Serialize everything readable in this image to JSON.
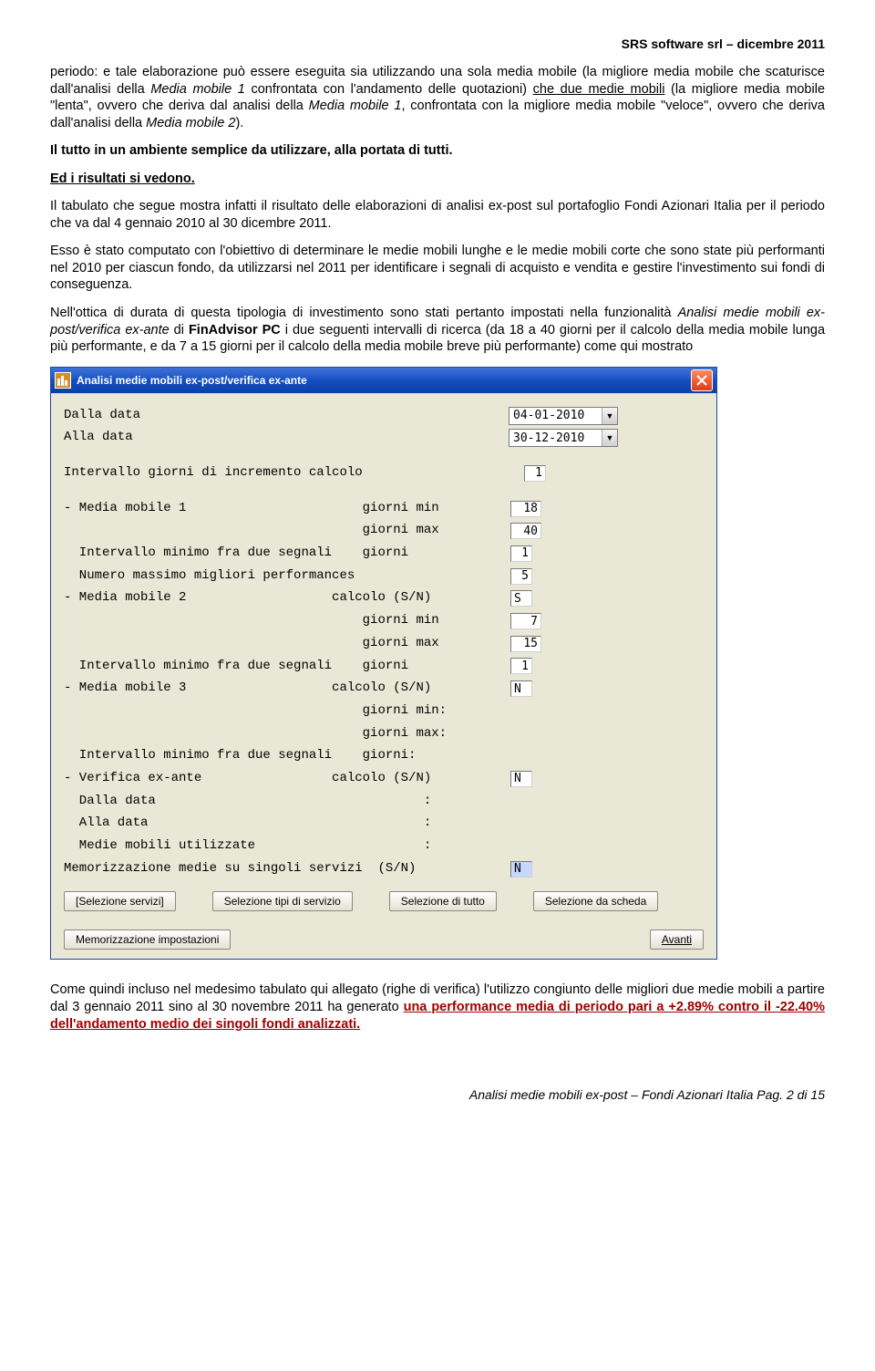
{
  "header": {
    "right": "SRS software srl – dicembre 2011"
  },
  "para1_a": "periodo: e tale elaborazione può essere eseguita sia utilizzando una sola media mobile (la migliore media mobile che scaturisce dall'analisi della ",
  "para1_b": "Media mobile 1",
  "para1_c": " confrontata con l'andamento delle quotazioni) ",
  "para1_d": "che due medie mobili",
  "para1_e": " (la migliore media mobile \"lenta\", ovvero che deriva dal analisi della ",
  "para1_f": "Media mobile 1",
  "para1_g": ", confrontata con la migliore media mobile \"veloce\", ovvero che deriva dall'analisi della ",
  "para1_h": "Media mobile 2",
  "para1_i": ").",
  "para2": "Il tutto in un ambiente semplice da utilizzare, alla portata di tutti.",
  "para3": "Ed i risultati si vedono.",
  "para4": "Il tabulato che segue mostra infatti il risultato delle elaborazioni di analisi ex-post sul portafoglio Fondi Azionari Italia per il periodo che va dal 4 gennaio 2010 al 30 dicembre 2011.",
  "para5": "Esso è stato computato con l'obiettivo di determinare le medie mobili lunghe e le medie mobili corte che sono state più performanti nel 2010 per ciascun fondo, da utilizzarsi nel 2011 per identificare i segnali di acquisto e vendita e gestire l'investimento sui fondi di conseguenza.",
  "para6_a": "Nell'ottica di durata di questa tipologia di investimento sono stati pertanto impostati nella funzionalità ",
  "para6_b": "Analisi medie mobili ex-post/verifica ex-ante",
  "para6_c": " di ",
  "para6_d": "FinAdvisor PC",
  "para6_e": " i due seguenti intervalli di ricerca (da 18 a 40 giorni per il calcolo della media mobile lunga più performante, e da 7 a 15 giorni per il calcolo della media mobile breve più performante) come qui mostrato",
  "dialog": {
    "title": "Analisi medie mobili ex-post/verifica ex-ante",
    "labels": {
      "dalla": "Dalla data",
      "alla": "Alla data",
      "intervallo_incr": "Intervallo giorni di incremento calcolo",
      "mm1": "- Media mobile 1                       giorni min",
      "mm1_max": "                                       giorni max",
      "mm1_int": "  Intervallo minimo fra due segnali    giorni",
      "mm1_num": "  Numero massimo migliori performances",
      "mm2": "- Media mobile 2                   calcolo (S/N)",
      "mm2_min": "                                       giorni min",
      "mm2_max": "                                       giorni max",
      "mm2_int": "  Intervallo minimo fra due segnali    giorni",
      "mm3": "- Media mobile 3                   calcolo (S/N)",
      "mm3_min": "                                       giorni min:",
      "mm3_max": "                                       giorni max:",
      "mm3_int": "  Intervallo minimo fra due segnali    giorni:",
      "verifica": "- Verifica ex-ante                 calcolo (S/N)",
      "ver_dalla": "  Dalla data                                   :",
      "ver_alla": "  Alla data                                    :",
      "ver_mm": "  Medie mobili utilizzate                      :",
      "memo": "Memorizzazione medie su singoli servizi  (S/N)"
    },
    "values": {
      "dalla": "04-01-2010",
      "alla": "30-12-2010",
      "incr": "1",
      "mm1_min": "18",
      "mm1_max": "40",
      "mm1_int": "1",
      "mm1_num": "5",
      "mm2_calc": "S",
      "mm2_min": "7",
      "mm2_max": "15",
      "mm2_int": "1",
      "mm3_calc": "N",
      "ver_calc": "N",
      "memo": "N"
    },
    "buttons": {
      "b1": "[Selezione servizi]",
      "b2": "Selezione tipi di servizio",
      "b3": "Selezione di tutto",
      "b4": "Selezione da scheda",
      "b5": "Memorizzazione impostazioni",
      "avanti": "Avanti"
    }
  },
  "para7_a": "Come quindi incluso nel medesimo tabulato qui allegato (righe di verifica) l'utilizzo congiunto delle migliori due medie mobili a partire dal 3 gennaio 2011 sino al 30 novembre 2011 ha generato ",
  "para7_b": "una performance media di periodo pari a +2.89% contro il -22.40% dell'andamento medio dei singoli fondi analizzati.",
  "footer": "Analisi medie mobili ex-post – Fondi Azionari Italia  Pag.  2  di 15"
}
